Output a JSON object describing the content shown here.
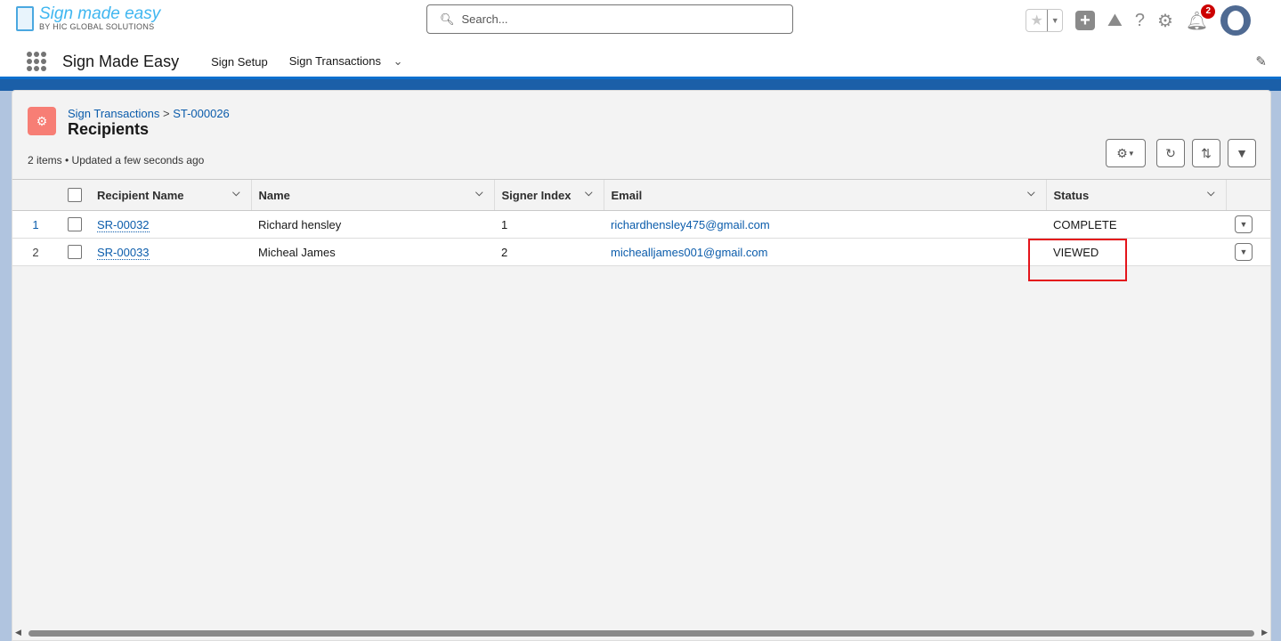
{
  "logo": {
    "title": "Sign made easy",
    "subtitle": "BY HIC GLOBAL SOLUTIONS"
  },
  "search": {
    "placeholder": "Search..."
  },
  "notifications": {
    "count": "2"
  },
  "nav": {
    "app_name": "Sign Made Easy",
    "items": [
      "Sign Setup",
      "Sign Transactions"
    ]
  },
  "page": {
    "breadcrumb": [
      "Sign Transactions",
      "ST-000026"
    ],
    "breadcrumb_sep": ">",
    "title": "Recipients",
    "meta": "2 items • Updated a few seconds ago"
  },
  "table": {
    "columns": [
      "Recipient Name",
      "Name",
      "Signer Index",
      "Email",
      "Status"
    ],
    "rows": [
      {
        "n": "1",
        "id": "SR-00032",
        "name": "Richard hensley",
        "index": "1",
        "email": "richardhensley475@gmail.com",
        "status": "COMPLETE"
      },
      {
        "n": "2",
        "id": "SR-00033",
        "name": "Micheal James",
        "index": "2",
        "email": "michealljames001@gmail.com",
        "status": "VIEWED"
      }
    ]
  },
  "colors": {
    "accent": "#0b5cab",
    "highlight": "#e4141b",
    "object_icon": "#f77e75"
  }
}
